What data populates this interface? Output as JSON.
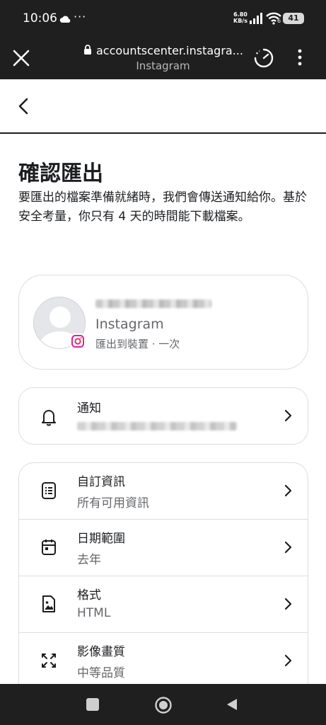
{
  "status_bar": {
    "time": "10:06",
    "more": "···",
    "speed_value": "6.80",
    "speed_unit": "KB/s",
    "wifi_label": "6",
    "battery": "41"
  },
  "browser": {
    "url": "accountscenter.instagra...",
    "site_name": "Instagram"
  },
  "page": {
    "title": "確認匯出",
    "description": "要匯出的檔案準備就緒時，我們會傳送通知給你。基於安全考量，你只有 4 天的時間能下載檔案。"
  },
  "profile": {
    "app": "Instagram",
    "subtitle": "匯出到裝置 · 一次"
  },
  "notification": {
    "title": "通知"
  },
  "settings": [
    {
      "title": "自訂資訊",
      "value": "所有可用資訊",
      "icon": "list-document-icon"
    },
    {
      "title": "日期範圍",
      "value": "去年",
      "icon": "calendar-icon"
    },
    {
      "title": "格式",
      "value": "HTML",
      "icon": "image-file-icon"
    },
    {
      "title": "影像畫質",
      "value": "中等品質",
      "icon": "expand-arrows-icon"
    }
  ],
  "colors": {
    "text_primary": "#1c1e21",
    "text_secondary": "#65676b",
    "border": "#dadde1",
    "system_bar": "#1f1f1f"
  }
}
